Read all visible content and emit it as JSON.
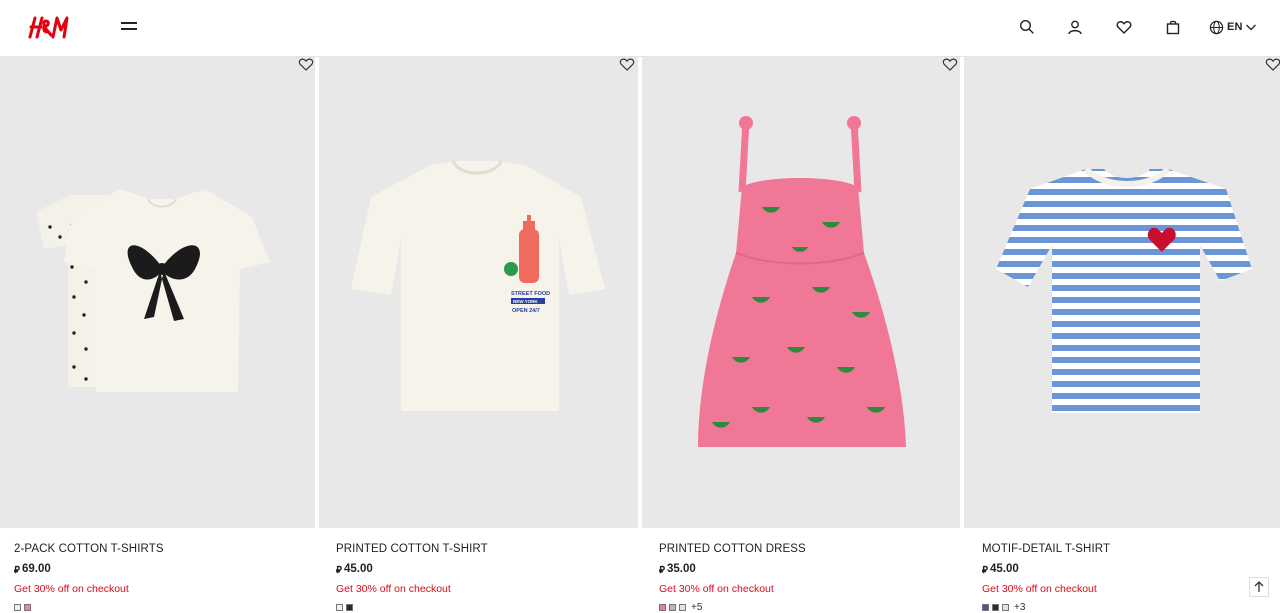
{
  "header": {
    "logo_text": "H&M",
    "brand_color": "#e50010",
    "menu_icon": "hamburger-icon",
    "icons": [
      "search-icon",
      "account-icon",
      "favorites-icon",
      "shopping-bag-icon"
    ],
    "language": {
      "icon": "globe-icon",
      "label": "EN"
    }
  },
  "products": [
    {
      "name": "2-PACK COTTON T-SHIRTS",
      "currency_symbol": "⃃",
      "price": "69.00",
      "promo": "Get 30% off on checkout",
      "swatches": [
        "#f2efe6",
        "#e48a96"
      ],
      "more_colors": ""
    },
    {
      "name": "PRINTED COTTON T-SHIRT",
      "currency_symbol": "⃃",
      "price": "45.00",
      "promo": "Get 30% off on checkout",
      "swatches": [
        "#f2efe6",
        "#2b2b2b"
      ],
      "more_colors": ""
    },
    {
      "name": "PRINTED COTTON DRESS",
      "currency_symbol": "⃃",
      "price": "35.00",
      "promo": "Get 30% off on checkout",
      "swatches": [
        "#ef7f99",
        "#b9b9ae",
        "#e6e3da"
      ],
      "more_colors": "+5"
    },
    {
      "name": "MOTIF-DETAIL T-SHIRT",
      "currency_symbol": "⃃",
      "price": "45.00",
      "promo": "Get 30% off on checkout",
      "swatches": [
        "#3a5aa8",
        "#2b2b2b",
        "#e6e3da"
      ],
      "more_colors": "+3"
    }
  ],
  "promo_color": "#d90b1c",
  "scroll_top_icon": "arrow-up-icon"
}
